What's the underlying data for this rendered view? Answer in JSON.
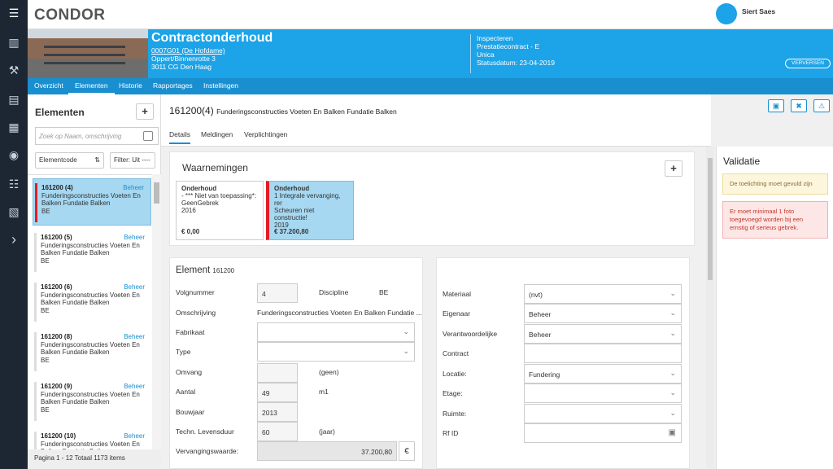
{
  "app": {
    "logo": "CONDOR",
    "user": "Siert Saes"
  },
  "rail": {
    "icons": [
      "menu-icon",
      "building-icon",
      "tools-icon",
      "document-stack-icon",
      "calendar-icon",
      "alarm-icon",
      "checklist-icon",
      "report-icon",
      "chevron-right-icon"
    ]
  },
  "banner": {
    "title": "Contractonderhoud",
    "code": "0007G01 (De Hofdame)",
    "street": "Oppert/Binnenrotte 3",
    "city": "3011 CG Den Haag",
    "info": [
      "Inspecteren",
      "Prestatiecontract - E",
      "Unica",
      "Statusdatum: 23-04-2019"
    ],
    "refresh": "VERVERSEN"
  },
  "tabs": [
    "Overzicht",
    "Elementen",
    "Historie",
    "Rapportages",
    "Instellingen"
  ],
  "left": {
    "title": "Elementen",
    "add": "+",
    "search_placeholder": "Zoek op Naam, omschrijving",
    "sort": "Elementcode",
    "filter": "Filter: Uit ----",
    "pager": "Pagina 1 - 12 Totaal 1173 items",
    "items": [
      {
        "num": "161200 (4)",
        "tag": "Beheer",
        "desc": "Funderingsconstructies Voeten En Balken Fundatie Balken",
        "dis": "BE"
      },
      {
        "num": "161200 (5)",
        "tag": "Beheer",
        "desc": "Funderingsconstructies Voeten En Balken Fundatie Balken",
        "dis": "BE"
      },
      {
        "num": "161200 (6)",
        "tag": "Beheer",
        "desc": "Funderingsconstructies Voeten En Balken Fundatie Balken",
        "dis": "BE"
      },
      {
        "num": "161200 (8)",
        "tag": "Beheer",
        "desc": "Funderingsconstructies Voeten En Balken Fundatie Balken",
        "dis": "BE"
      },
      {
        "num": "161200 (9)",
        "tag": "Beheer",
        "desc": "Funderingsconstructies Voeten En Balken Fundatie Balken",
        "dis": "BE"
      },
      {
        "num": "161200 (10)",
        "tag": "Beheer",
        "desc": "Funderingsconstructies Voeten En Balken Fundatie Balken",
        "dis": "BE"
      }
    ]
  },
  "content": {
    "title": "161200(4)",
    "subtitle": "Funderingsconstructies Voeten En Balken Fundatie Balken",
    "tabs": [
      "Details",
      "Meldingen",
      "Verplichtingen"
    ],
    "obs_title": "Waarnemingen",
    "obs_add": "+",
    "obs": [
      {
        "head": "Onderhoud",
        "l1": "- *** Niet van toepassing*:",
        "l2": "GeenGebrek",
        "l3": "2016",
        "price": "€ 0,00"
      },
      {
        "head": "Onderhoud",
        "l1": "1 Integrale vervanging, rer",
        "l2": "Scheuren niet constructie!",
        "l3": "2019",
        "price": "€ 37.200,80"
      }
    ],
    "el_title": "Element",
    "el_code": "161200",
    "f": {
      "volg": "Volgnummer",
      "volg_v": "4",
      "disc": "Discipline",
      "disc_v": "BE",
      "oms": "Omschrijving",
      "oms_v": "Funderingsconstructies Voeten En Balken Fundatie ...",
      "fab": "Fabrikaat",
      "type": "Type",
      "omvang": "Omvang",
      "omvang_u": "(geen)",
      "aantal": "Aantal",
      "aantal_v": "49",
      "aantal_u": "m1",
      "bouw": "Bouwjaar",
      "bouw_v": "2013",
      "levens": "Techn. Levensduur",
      "levens_v": "60",
      "levens_u": "(jaar)",
      "verv": "Vervangingswaarde:",
      "verv_v": "37.200,80",
      "euro": "€"
    },
    "r": {
      "mat": "Materiaal",
      "mat_v": "(nvt)",
      "eig": "Eigenaar",
      "eig_v": "Beheer",
      "ver": "Verantwoordelijke",
      "ver_v": "Beheer",
      "con": "Contract",
      "loc": "Locatie:",
      "loc_v": "Fundering",
      "eta": "Etage:",
      "rui": "Ruimte:",
      "rf": "Rf ID"
    }
  },
  "validation": {
    "title": "Validatie",
    "warn": "De toelichting moet gevuld zijn",
    "err": "Er moet minimaal 1 foto toegevoegd worden bij een ernstig of serieus gebrek."
  }
}
